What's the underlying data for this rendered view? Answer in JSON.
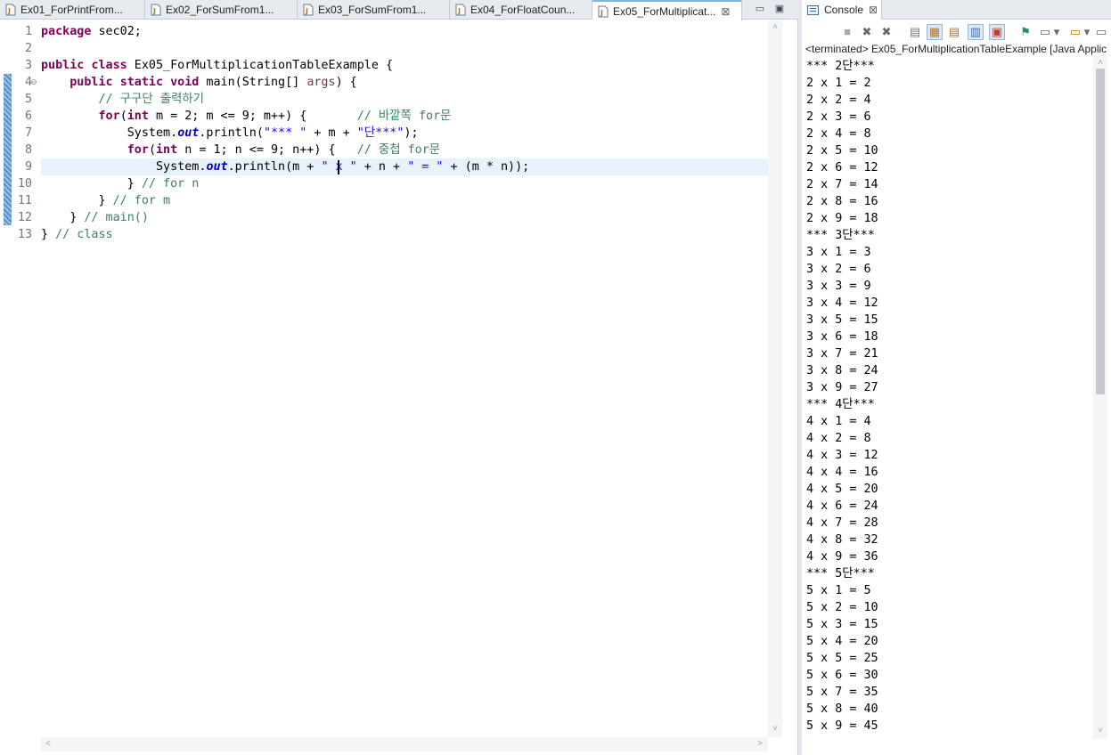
{
  "editor": {
    "tabs": [
      {
        "label": "Ex01_ForPrintFrom..."
      },
      {
        "label": "Ex02_ForSumFrom1..."
      },
      {
        "label": "Ex03_ForSumFrom1..."
      },
      {
        "label": "Ex04_ForFloatCoun..."
      },
      {
        "label": "Ex05_ForMultiplicat...",
        "active": true,
        "close": "⊠"
      }
    ],
    "minimize_glyph": "▭",
    "maximize_glyph": "▣",
    "line_numbers": [
      "1",
      "2",
      "3",
      "4",
      "5",
      "6",
      "7",
      "8",
      "9",
      "10",
      "11",
      "12",
      "13"
    ],
    "fold_glyph": "⊖",
    "code": {
      "l1": {
        "kw": "package",
        "rest": " sec02;"
      },
      "l3": {
        "kw1": "public",
        "kw2": "class",
        "rest": " Ex05_ForMultiplicationTableExample {"
      },
      "l4": {
        "indent": "    ",
        "kw1": "public",
        "kw2": "static",
        "kw3": "void",
        "mid": " main(String[] ",
        "param": "args",
        "end": ") {"
      },
      "l5": {
        "indent": "        ",
        "comment": "// 구구단 출력하기"
      },
      "l6": {
        "indent": "        ",
        "kw": "for",
        "a": "(",
        "kw2": "int",
        "b": " m = 2; m <= 9; m++) {       ",
        "comment": "// 바깥쪽 for문"
      },
      "l7": {
        "indent": "            ",
        "a": "System.",
        "field": "out",
        "b": ".println(",
        "s1": "\"*** \"",
        "c": " + m + ",
        "s2": "\"단***\"",
        "d": ");"
      },
      "l8": {
        "indent": "            ",
        "kw": "for",
        "a": "(",
        "kw2": "int",
        "b": " n = 1; n <= 9; n++) {   ",
        "comment": "// 중첩 for문"
      },
      "l9": {
        "indent": "                ",
        "a": "System.",
        "field": "out",
        "b": ".println(m + ",
        "s1": "\" x \"",
        "c": " + n + ",
        "s2": "\" = \"",
        "d": " + (m * n));"
      },
      "l10": {
        "indent": "            ",
        "a": "} ",
        "comment": "// for n"
      },
      "l11": {
        "indent": "        ",
        "a": "} ",
        "comment": "// for m"
      },
      "l12": {
        "indent": "    ",
        "a": "} ",
        "comment": "// main()"
      },
      "l13": {
        "a": "} ",
        "comment": "// class"
      }
    }
  },
  "console": {
    "tab_label": "Console",
    "tab_close": "⊠",
    "status": "<terminated> Ex05_ForMultiplicationTableExample [Java Applic",
    "toolbar": {
      "terminate": "■",
      "remove": "✖",
      "remove_all": "✖",
      "scroll_lock": "▤",
      "word_wrap": "▦",
      "show_stdout": "▤",
      "show_stderr": "▥",
      "show_on_change": "▣",
      "pin": "⚑",
      "display": "▭",
      "display_dropdown": "▾",
      "new_console": "▭",
      "new_dropdown": "▾",
      "view_menu": "▭"
    },
    "output": [
      "*** 2단***",
      "2 x 1 = 2",
      "2 x 2 = 4",
      "2 x 3 = 6",
      "2 x 4 = 8",
      "2 x 5 = 10",
      "2 x 6 = 12",
      "2 x 7 = 14",
      "2 x 8 = 16",
      "2 x 9 = 18",
      "*** 3단***",
      "3 x 1 = 3",
      "3 x 2 = 6",
      "3 x 3 = 9",
      "3 x 4 = 12",
      "3 x 5 = 15",
      "3 x 6 = 18",
      "3 x 7 = 21",
      "3 x 8 = 24",
      "3 x 9 = 27",
      "*** 4단***",
      "4 x 1 = 4",
      "4 x 2 = 8",
      "4 x 3 = 12",
      "4 x 4 = 16",
      "4 x 5 = 20",
      "4 x 6 = 24",
      "4 x 7 = 28",
      "4 x 8 = 32",
      "4 x 9 = 36",
      "*** 5단***",
      "5 x 1 = 5",
      "5 x 2 = 10",
      "5 x 3 = 15",
      "5 x 4 = 20",
      "5 x 5 = 25",
      "5 x 6 = 30",
      "5 x 7 = 35",
      "5 x 8 = 40",
      "5 x 9 = 45"
    ]
  },
  "scroll_glyphs": {
    "up": "˄",
    "down": "˅",
    "left": "<",
    "right": ">"
  }
}
